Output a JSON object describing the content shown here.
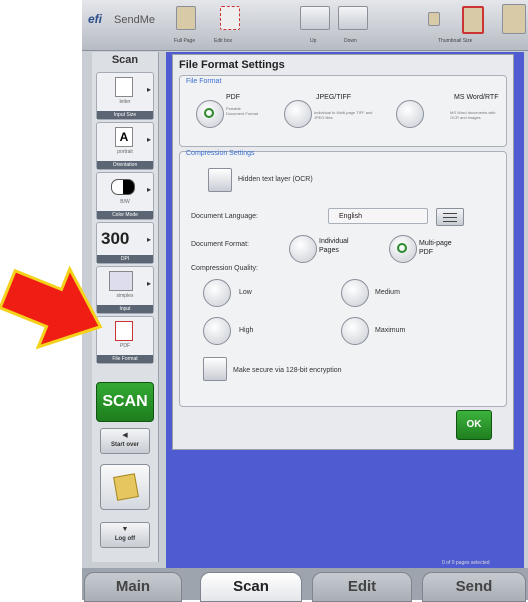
{
  "topbar": {
    "logo": "efi",
    "app_name": "SendMe",
    "buttons": [
      "Full Page",
      "Edit box",
      "Up",
      "Down",
      "Thumbnail Size"
    ]
  },
  "sidebar": {
    "title": "Scan",
    "input_size": {
      "value": "letter",
      "caption": "Input Size"
    },
    "orientation": {
      "value": "portrait",
      "caption": "Orientation"
    },
    "color_mode": {
      "value": "B/W",
      "caption": "Color Mode"
    },
    "dpi": {
      "value": "300",
      "caption": "DPI"
    },
    "input": {
      "value": "simplex",
      "caption": "Input"
    },
    "file_format": {
      "value": "PDF",
      "caption": "File Format"
    },
    "scan_label": "SCAN",
    "start_over": "Start over",
    "log_off": "Log off"
  },
  "dialog": {
    "title": "File Format Settings",
    "file_format_section": "File Format",
    "options": [
      {
        "label": "PDF",
        "sub": "Portable Document Format",
        "selected": true
      },
      {
        "label": "JPEG/TIFF",
        "sub": "Individual to Multi-page TIFF and JPEG files",
        "selected": false
      },
      {
        "label": "MS Word/RTF",
        "sub": "MS Word documents with OCR and images",
        "selected": false
      }
    ],
    "compression_section": "Compression Settings",
    "hidden_text": "Hidden text layer (OCR)",
    "doc_language_label": "Document Language:",
    "doc_language_value": "English",
    "doc_format_label": "Document Format:",
    "individual_pages": "Individual Pages",
    "multi_page_pdf": "Multi-page PDF",
    "compression_quality": "Compression Quality:",
    "low": "Low",
    "medium": "Medium",
    "high": "High",
    "maximum": "Maximum",
    "secure": "Make secure via 128-bit encryption",
    "ok": "OK"
  },
  "status": "0 of 0 pages selected",
  "tabs": [
    "Main",
    "Scan",
    "Edit",
    "Send"
  ],
  "colors": {
    "accent_green": "#2b8a2b",
    "main_blue": "#4e5bd1",
    "arrow_red": "#f01d14",
    "arrow_yellow": "#f4d21a"
  }
}
